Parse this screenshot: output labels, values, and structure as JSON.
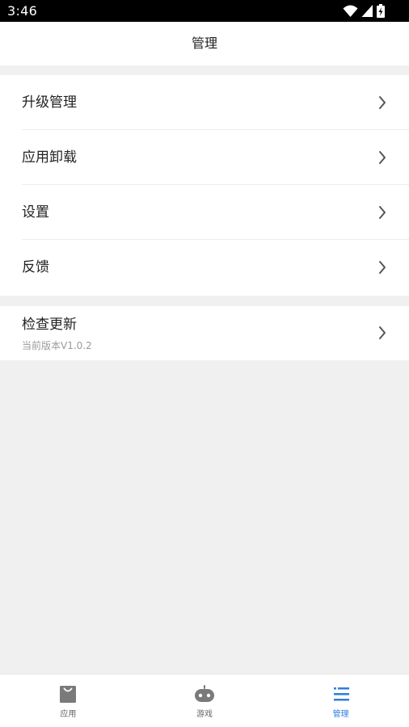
{
  "status_bar": {
    "time": "3:46"
  },
  "header": {
    "title": "管理"
  },
  "menu": {
    "items": [
      {
        "label": "升级管理"
      },
      {
        "label": "应用卸载"
      },
      {
        "label": "设置"
      },
      {
        "label": "反馈"
      }
    ],
    "update": {
      "title": "检查更新",
      "version_text": "当前版本V1.0.2"
    }
  },
  "bottom_nav": {
    "tabs": [
      {
        "label": "应用",
        "icon": "shopping-bag-icon",
        "active": false
      },
      {
        "label": "游戏",
        "icon": "gamepad-icon",
        "active": false
      },
      {
        "label": "管理",
        "icon": "list-icon",
        "active": true
      }
    ]
  },
  "colors": {
    "accent": "#2f7de1",
    "background": "#f0f0f0",
    "surface": "#ffffff",
    "text_primary": "#222222",
    "text_secondary": "#9a9a9a",
    "nav_inactive": "#666666",
    "status_bar": "#000000"
  },
  "icons": {
    "status": [
      "wifi-icon",
      "cellular-signal-icon",
      "battery-charging-icon"
    ],
    "row_arrow": "chevron-right-icon"
  }
}
